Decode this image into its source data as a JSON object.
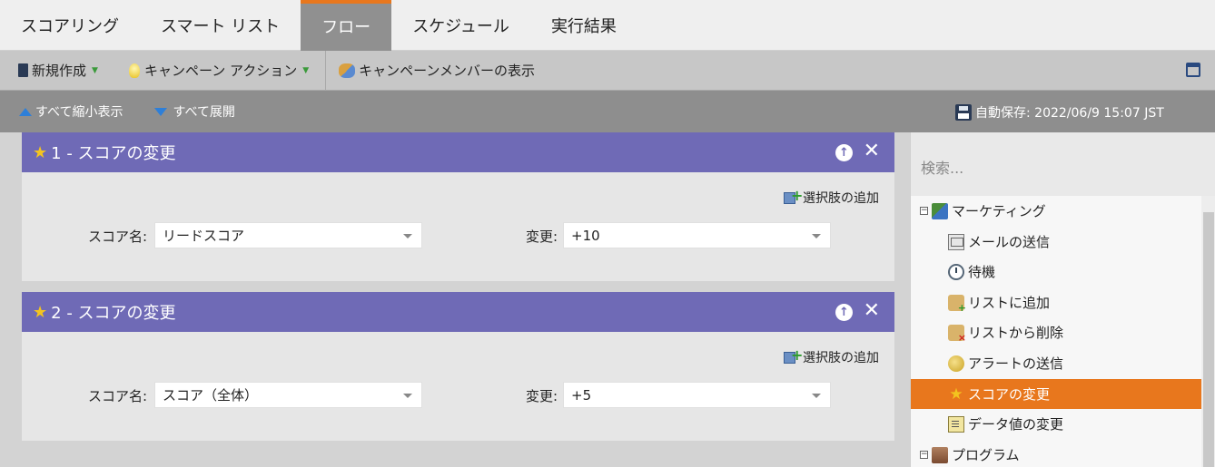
{
  "tabs": [
    {
      "label": "スコアリング",
      "active": false
    },
    {
      "label": "スマート リスト",
      "active": false
    },
    {
      "label": "フロー",
      "active": true
    },
    {
      "label": "スケジュール",
      "active": false
    },
    {
      "label": "実行結果",
      "active": false
    }
  ],
  "toolbar": {
    "new_label": "新規作成",
    "campaign_action_label": "キャンペーン アクション",
    "show_members_label": "キャンペーンメンバーの表示"
  },
  "subbar": {
    "collapse_all_label": "すべて縮小表示",
    "expand_all_label": "すべて展開",
    "autosave_label": "自動保存: 2022/06/9 15:07 JST"
  },
  "steps": [
    {
      "title": "1 - スコアの変更",
      "add_choice_label": "選択肢の追加",
      "score_name_label": "スコア名:",
      "score_name_value": "リードスコア",
      "change_label": "変更:",
      "change_value": "+10"
    },
    {
      "title": "2 - スコアの変更",
      "add_choice_label": "選択肢の追加",
      "score_name_label": "スコア名:",
      "score_name_value": "スコア（全体）",
      "change_label": "変更:",
      "change_value": "+5"
    }
  ],
  "right_pane": {
    "search_placeholder": "検索...",
    "tree": [
      {
        "label": "マーケティング",
        "icon": "marketing-folder-icon",
        "expander": "⊟",
        "level": 0
      },
      {
        "label": "メールの送信",
        "icon": "mail-icon",
        "level": 1
      },
      {
        "label": "待機",
        "icon": "clock-icon",
        "level": 1
      },
      {
        "label": "リストに追加",
        "icon": "list-add-icon",
        "level": 1
      },
      {
        "label": "リストから削除",
        "icon": "list-remove-icon",
        "level": 1
      },
      {
        "label": "アラートの送信",
        "icon": "alert-bell-icon",
        "level": 1
      },
      {
        "label": "スコアの変更",
        "icon": "star-icon",
        "level": 1,
        "selected": true
      },
      {
        "label": "データ値の変更",
        "icon": "data-edit-icon",
        "level": 1
      },
      {
        "label": "プログラム",
        "icon": "program-folder-icon",
        "expander": "⊟",
        "level": 0
      }
    ]
  },
  "colors": {
    "active_tab_accent": "#e8771d",
    "step_header": "#6f6ab6",
    "selected_node": "#e8771d"
  }
}
